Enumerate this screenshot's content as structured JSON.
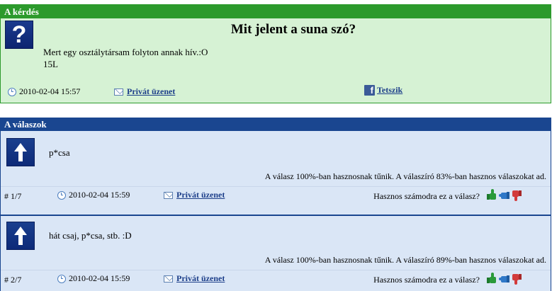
{
  "question": {
    "header": "A kérdés",
    "icon": "question-mark-icon",
    "title": "Mit jelent a suna szó?",
    "body_line1": "Mert egy osztálytársam folyton annak hív.:O",
    "body_line2": "15L",
    "date": "2010-02-04 15:57",
    "private_message": "Privát üzenet",
    "like": "Tetszik",
    "colors": {
      "header": "#2c9a2c",
      "background": "#d6f2d4"
    }
  },
  "answers": {
    "header": "A válaszok",
    "colors": {
      "header": "#1a4690",
      "background": "#dae6f6"
    },
    "items": [
      {
        "text": "p*csa",
        "stat": "A válasz 100%-ban hasznosnak tűnik. A válaszíró 83%-ban hasznos válaszokat ad.",
        "num": "# 1/7",
        "date": "2010-02-04 15:59",
        "private_message": "Privát üzenet",
        "useful_question": "Hasznos számodra ez a válasz?"
      },
      {
        "text": "hát csaj, p*csa, stb. :D",
        "stat": "A válasz 100%-ban hasznosnak tűnik. A válaszíró 89%-ban hasznos válaszokat ad.",
        "num": "# 2/7",
        "date": "2010-02-04 15:59",
        "private_message": "Privát üzenet",
        "useful_question": "Hasznos számodra ez a válasz?"
      }
    ]
  }
}
